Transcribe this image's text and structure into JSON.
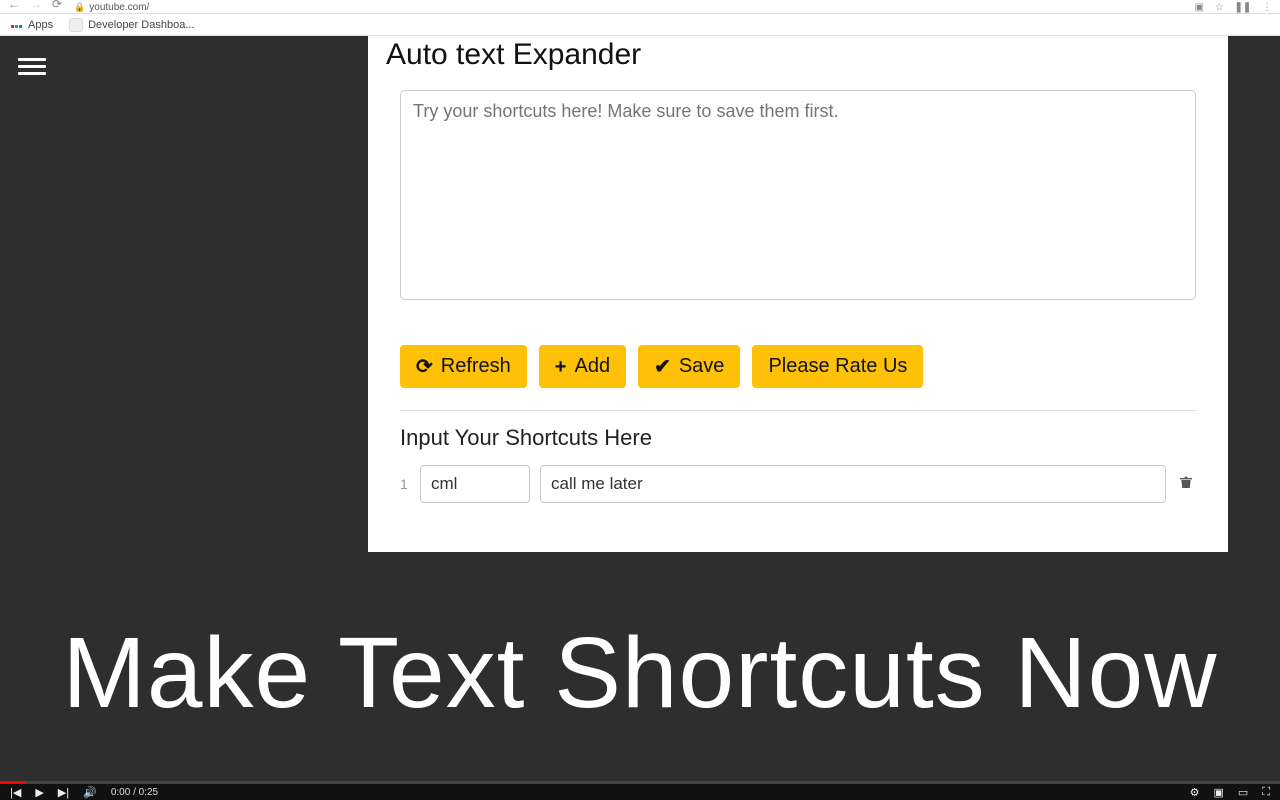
{
  "browser": {
    "url": "youtube.com/",
    "apps_label": "Apps",
    "bookmarks": [
      "Developer Dashboa..."
    ]
  },
  "extension": {
    "title": "Auto text Expander",
    "try_placeholder": "Try your shortcuts here! Make sure to save them first.",
    "try_value": "",
    "buttons": {
      "refresh": "Refresh",
      "add": "Add",
      "save": "Save",
      "rate": "Please Rate Us"
    },
    "subheading": "Input Your Shortcuts Here",
    "rows": [
      {
        "num": "1",
        "key": "cml",
        "value": "call me later"
      }
    ]
  },
  "hero_text": "Make Text Shortcuts Now",
  "player": {
    "current": "0:00",
    "duration": "0:25"
  }
}
